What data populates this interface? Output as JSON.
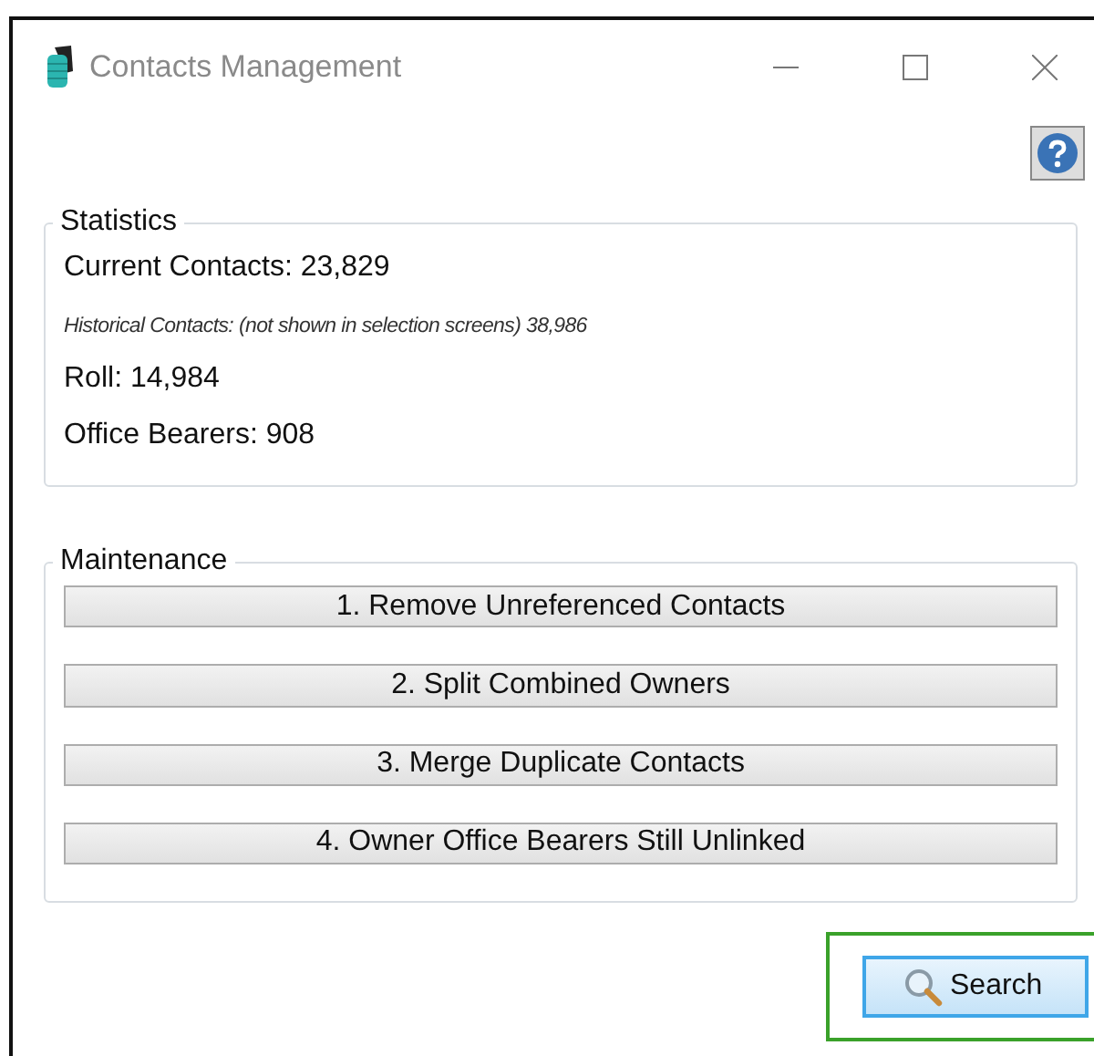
{
  "window": {
    "title": "Contacts Management"
  },
  "statistics": {
    "title": "Statistics",
    "rows": [
      {
        "kind": "normal",
        "text": "Current Contacts: 23,829"
      },
      {
        "kind": "note",
        "text": "Historical Contacts: (not shown in selection screens) 38,986"
      },
      {
        "kind": "normal",
        "text": "Roll: 14,984"
      },
      {
        "kind": "normal",
        "text": "Office Bearers: 908"
      }
    ]
  },
  "maintenance": {
    "title": "Maintenance",
    "buttons": [
      "1. Remove Unreferenced Contacts",
      "2. Split Combined Owners",
      "3. Merge Duplicate Contacts",
      "4. Owner Office Bearers Still Unlinked"
    ]
  },
  "search_button": {
    "label": "Search",
    "highlighted": true
  }
}
